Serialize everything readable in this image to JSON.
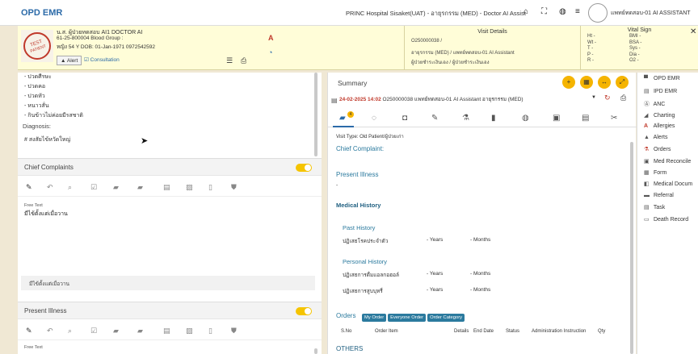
{
  "topbar": {
    "brand": "OPD EMR",
    "hospital": "PRINC Hospital Sisaket(UAT) - อายุรกรรม (MED) - Doctor AI Assist",
    "user": "แพทย์ทดสอบ-01 AI ASSISTANT"
  },
  "patient": {
    "name": "น.ส. ผู้ป่วยทดสอบ AI1 DOCTOR AI",
    "hn_line": "61-25-800004 Blood Group :",
    "age_line": "หญิง 54 Y  DOB: 01-Jan-1971 0972542592",
    "alert_label": "Alert",
    "consult_label": "Consultation",
    "photo_label": "TEST PATIENT"
  },
  "visit": {
    "title": "Visit Details",
    "line1": "O250000038 /",
    "line2": "อายุรกรรม (MED) / แพทย์ทดสอบ-01 AI Assistant",
    "line3": "ผู้ป่วยชำระเงินเอง / ผู้ป่วยชำระเงินเอง"
  },
  "vital": {
    "title": "Vital Sign",
    "left": [
      "Ht -",
      "Wt -",
      "T -",
      "P -",
      "R -"
    ],
    "right": [
      "BMI -",
      "BSA -",
      "Sys -",
      "Dia -",
      "O2 -"
    ]
  },
  "left_panel": {
    "items": [
      "- ปวดศีรษะ",
      "- ปวดคอ",
      "- ปวดหัว",
      "- หนาวสั่น",
      "- กินข้าวไม่ค่อยมีรสชาติ"
    ],
    "diagnosis_label": "Diagnosis:",
    "diagnosis_value": "# สงสัยไข้หวัดใหญ่",
    "chief_complaints": "Chief Complaints",
    "freetext_label": "Free Text",
    "cc_value": "มีไข้ตั้งแต่เมื่อวาน",
    "cc_bar": "มีไข้ตั้งแต่เมื่อวาน",
    "present_illness": "Present Illness",
    "freetext_label2": "Free Text"
  },
  "summary": {
    "title": "Summary",
    "episode_date": "24-02-2025 14:02",
    "episode_rest": "O250000038 แพทย์ทดสอบ-01 AI Assistant อายุรกรรม (MED)",
    "visit_type": "Visit Type:  Old Patient/ผู้ป่วยเก่า",
    "chief_complaint": "Chief Complaint:",
    "present_illness": "Present Illness",
    "dash": "-",
    "medical_history": "Medical History",
    "past_history": "Past History",
    "past_row": {
      "label": "ปฏิเสธโรคประจำตัว",
      "years": "- Years",
      "months": "- Months"
    },
    "personal_history": "Personal History",
    "personal_rows": [
      {
        "label": "ปฏิเสธการดื่มแอลกอฮอล์",
        "years": "- Years",
        "months": "- Months"
      },
      {
        "label": "ปฏิเสธการสูบบุหรี่",
        "years": "- Years",
        "months": "- Months"
      }
    ],
    "orders_label": "Orders",
    "order_pills": [
      "My Order",
      "Everyone Order",
      "Order Category"
    ],
    "columns": [
      "S.No",
      "Order Item",
      "Details",
      "End Date",
      "Status",
      "Administration Instruction",
      "Qty"
    ],
    "others": "OTHERS"
  },
  "right_menu": [
    {
      "icon": "ipd-icon",
      "glyph": "▀",
      "label": "OPD EMR"
    },
    {
      "icon": "ipd-icon",
      "glyph": "▤",
      "label": "IPD EMR"
    },
    {
      "icon": "anc-icon",
      "glyph": "Ⓐ",
      "label": "ANC"
    },
    {
      "icon": "charting-icon",
      "glyph": "◢",
      "label": "Charting"
    },
    {
      "icon": "allergy-icon",
      "glyph": "A",
      "label": "Allergies"
    },
    {
      "icon": "alert-icon",
      "glyph": "▲",
      "label": "Alerts"
    },
    {
      "icon": "orders-icon",
      "glyph": "⚗",
      "label": "Orders"
    },
    {
      "icon": "med-reconcile-icon",
      "glyph": "▣",
      "label": "Med Reconcile"
    },
    {
      "icon": "form-icon",
      "glyph": "▦",
      "label": "Form"
    },
    {
      "icon": "medical-doc-icon",
      "glyph": "◧",
      "label": "Medical Docum"
    },
    {
      "icon": "referral-icon",
      "glyph": "▬",
      "label": "Referral"
    },
    {
      "icon": "task-icon",
      "glyph": "▤",
      "label": "Task"
    },
    {
      "icon": "death-record-icon",
      "glyph": "▭",
      "label": "Death Record"
    }
  ]
}
